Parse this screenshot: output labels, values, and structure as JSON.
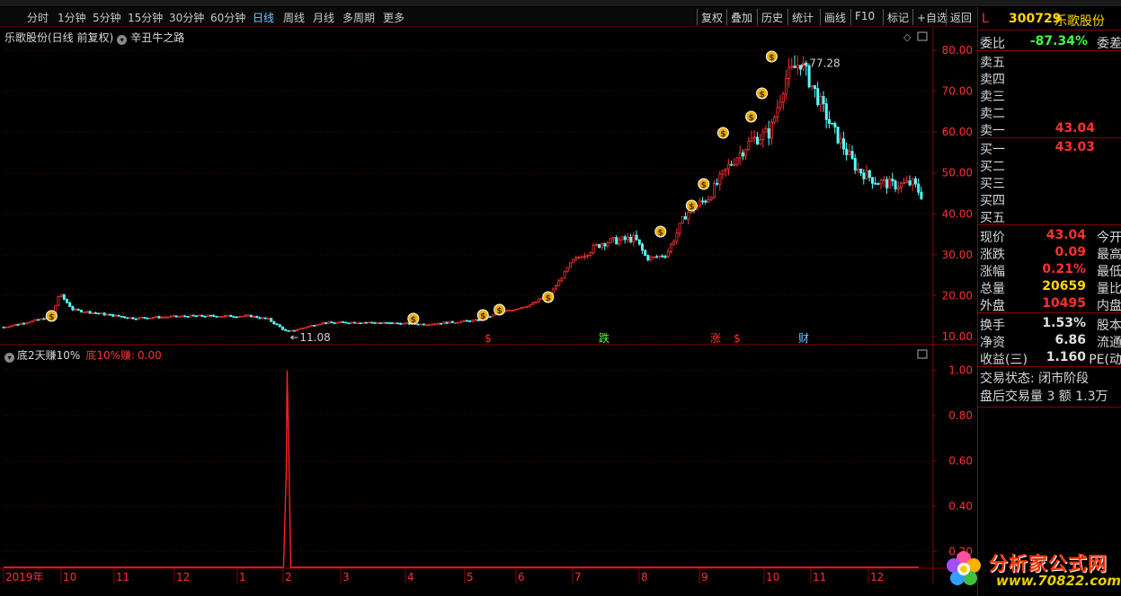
{
  "toolbar": {
    "periods": [
      {
        "label": "分时",
        "x": 30
      },
      {
        "label": "1分钟",
        "x": 64
      },
      {
        "label": "5分钟",
        "x": 103
      },
      {
        "label": "15分钟",
        "x": 142
      },
      {
        "label": "30分钟",
        "x": 188
      },
      {
        "label": "60分钟",
        "x": 234
      },
      {
        "label": "日线",
        "x": 281,
        "active": true
      },
      {
        "label": "周线",
        "x": 315
      },
      {
        "label": "月线",
        "x": 348
      },
      {
        "label": "多周期",
        "x": 381
      },
      {
        "label": "更多",
        "x": 426
      }
    ],
    "buttons": [
      "复权",
      "叠加",
      "历史",
      "统计",
      "画线",
      "F10",
      "标记",
      "+自选",
      "返回"
    ]
  },
  "title": {
    "stock": "乐歌股份(日线 前复权)",
    "formula": "辛丑牛之路"
  },
  "indicator": {
    "name": "底2天赚10%",
    "value_label": "底10%赚:",
    "value": "0.00"
  },
  "header": {
    "flag": "L",
    "code": "300729",
    "name": "乐歌股份"
  },
  "quote": {
    "weibi_label": "委比",
    "weibi": "-87.34%",
    "weicha_label": "委差",
    "asks": [
      {
        "label": "卖五",
        "price": ""
      },
      {
        "label": "卖四",
        "price": ""
      },
      {
        "label": "卖三",
        "price": ""
      },
      {
        "label": "卖二",
        "price": ""
      },
      {
        "label": "卖一",
        "price": "43.04"
      }
    ],
    "bids": [
      {
        "label": "买一",
        "price": "43.03"
      },
      {
        "label": "买二",
        "price": ""
      },
      {
        "label": "买三",
        "price": ""
      },
      {
        "label": "买四",
        "price": ""
      },
      {
        "label": "买五",
        "price": ""
      }
    ],
    "stats": [
      {
        "label": "现价",
        "value": "43.04",
        "label2": "今开",
        "color": "#ff3030"
      },
      {
        "label": "涨跌",
        "value": "0.09",
        "label2": "最高",
        "color": "#ff3030"
      },
      {
        "label": "涨幅",
        "value": "0.21%",
        "label2": "最低",
        "color": "#ff3030"
      },
      {
        "label": "总量",
        "value": "20659",
        "label2": "量比",
        "color": "#ffd700"
      },
      {
        "label": "外盘",
        "value": "10495",
        "label2": "内盘",
        "color": "#ff3030"
      }
    ],
    "stats2": [
      {
        "label": "换手",
        "value": "1.53%",
        "label2": "股本",
        "color": "#e0e0e0"
      },
      {
        "label": "净资",
        "value": "6.86",
        "label2": "流通",
        "color": "#e0e0e0"
      },
      {
        "label": "收益(三)",
        "value": "1.160",
        "label2": "PE(动",
        "color": "#e0e0e0"
      }
    ],
    "status": [
      "交易状态: 闭市阶段",
      "盘后交易量 3 额 1.3万"
    ]
  },
  "watermark": {
    "text": "分析家公式网",
    "url": "www.70822.com"
  },
  "colors": {
    "up": "#ff3030",
    "down": "#54ffff",
    "axis": "#8a0000",
    "grid": "#5a0000",
    "signal": "#ff2020"
  },
  "chart_data": [
    {
      "type": "candlestick",
      "title": "乐歌股份(日线 前复权)",
      "ylim": [
        8,
        82
      ],
      "yticks": [
        10,
        20,
        30,
        40,
        50,
        60,
        70,
        80
      ],
      "ytick_labels": [
        "10.00",
        "20.00",
        "30.00",
        "40.00",
        "50.00",
        "60.00",
        "70.00",
        "80.00"
      ],
      "x_ticks": [
        "2019年",
        "10",
        "11",
        "12",
        "1",
        "2",
        "3",
        "4",
        "5",
        "6",
        "7",
        "8",
        "9",
        "10",
        "11",
        "12"
      ],
      "close_trend": [
        [
          "2019-09",
          13.2
        ],
        [
          "2019-09-26",
          14.8
        ],
        [
          "2019-09-30",
          20.5
        ],
        [
          "2019-10-08",
          16.5
        ],
        [
          "2019-11",
          14.5
        ],
        [
          "2019-12",
          15.0
        ],
        [
          "2020-01",
          15.0
        ],
        [
          "2020-01-22",
          14.2
        ],
        [
          "2020-02-03",
          11.08
        ],
        [
          "2020-02-20",
          13.3
        ],
        [
          "2020-03",
          13.5
        ],
        [
          "2020-04",
          13.0
        ],
        [
          "2020-05",
          14.0
        ],
        [
          "2020-05-20",
          15.5
        ],
        [
          "2020-06",
          18.0
        ],
        [
          "2020-06-20",
          21.0
        ],
        [
          "2020-07-01",
          28.5
        ],
        [
          "2020-07-15",
          33.0
        ],
        [
          "2020-07-30",
          34.0
        ],
        [
          "2020-08-05",
          29.0
        ],
        [
          "2020-08-15",
          30.0
        ],
        [
          "2020-08-25",
          40.0
        ],
        [
          "2020-09-05",
          44.0
        ],
        [
          "2020-09-15",
          52.0
        ],
        [
          "2020-09-25",
          58.0
        ],
        [
          "2020-10-05",
          60.0
        ],
        [
          "2020-10-15",
          73.0
        ],
        [
          "2020-10-25",
          77.28
        ],
        [
          "2020-11-05",
          68.0
        ],
        [
          "2020-11-12",
          61.0
        ],
        [
          "2020-11-25",
          51.0
        ],
        [
          "2020-12-05",
          48.0
        ],
        [
          "2020-12-15",
          47.0
        ],
        [
          "2020-12-25",
          47.5
        ],
        [
          "2021-01-05",
          43.04
        ]
      ],
      "annotations": [
        {
          "text": "11.08",
          "kind": "low"
        },
        {
          "text": "77.28",
          "kind": "high"
        }
      ],
      "markers": [
        "$",
        "跌",
        "涨",
        "$",
        "财"
      ]
    },
    {
      "type": "line",
      "series": [
        {
          "name": "底10%赚",
          "values": "0 except spike to 1.00 near 2020-02-03"
        }
      ],
      "ylim": [
        0.13,
        1.05
      ],
      "yticks": [
        0.2,
        0.4,
        0.6,
        0.8,
        1.0
      ],
      "ytick_labels": [
        "0.20",
        "0.40",
        "0.60",
        "0.80",
        "1.00"
      ]
    }
  ]
}
